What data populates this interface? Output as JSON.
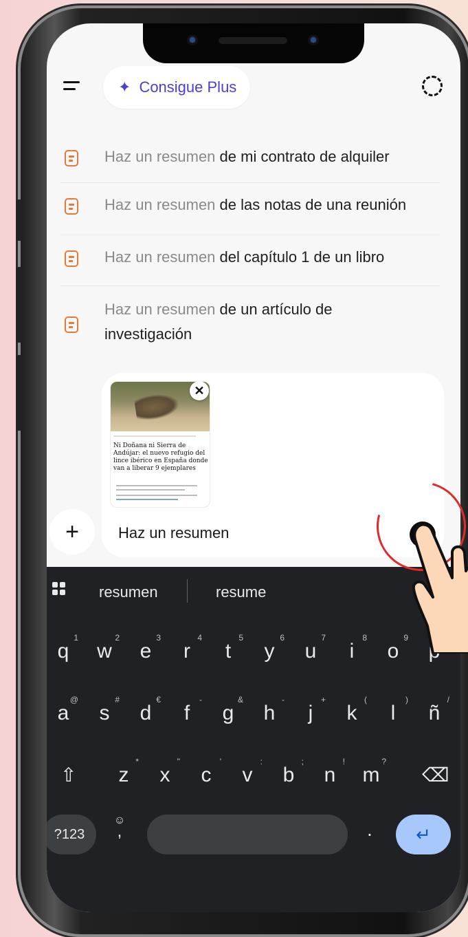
{
  "header": {
    "plus_label": "Consigue Plus"
  },
  "suggestions": [
    {
      "prefix": "Haz un resumen",
      "rest": "de mi contrato de alquiler"
    },
    {
      "prefix": "Haz un resumen",
      "rest": "de las notas de una reunión"
    },
    {
      "prefix": "Haz un resumen",
      "rest": "del capítulo 1 de un libro"
    },
    {
      "prefix": "Haz un resumen",
      "rest": "de un artículo de",
      "rest2": "investigación"
    }
  ],
  "attachment": {
    "headline": "Ni Doñana ni Sierra de Andújar: el nuevo refugio del lince ibérico en España donde van a liberar 9 ejemplares"
  },
  "composer": {
    "text": "Haz un resumen",
    "send_icon": "arrow-up-icon",
    "add_icon": "plus-icon"
  },
  "keyboard": {
    "suggestions": [
      "resumen",
      "resume"
    ],
    "row1": [
      {
        "k": "q",
        "s": "1"
      },
      {
        "k": "w",
        "s": "2"
      },
      {
        "k": "e",
        "s": "3"
      },
      {
        "k": "r",
        "s": "4"
      },
      {
        "k": "t",
        "s": "5"
      },
      {
        "k": "y",
        "s": "6"
      },
      {
        "k": "u",
        "s": "7"
      },
      {
        "k": "i",
        "s": "8"
      },
      {
        "k": "o",
        "s": "9"
      },
      {
        "k": "p",
        "s": "0"
      }
    ],
    "row2": [
      {
        "k": "a",
        "s": "@"
      },
      {
        "k": "s",
        "s": "#"
      },
      {
        "k": "d",
        "s": "€"
      },
      {
        "k": "f",
        "s": "-"
      },
      {
        "k": "g",
        "s": "&"
      },
      {
        "k": "h",
        "s": "-"
      },
      {
        "k": "j",
        "s": "+"
      },
      {
        "k": "k",
        "s": "("
      },
      {
        "k": "l",
        "s": ")"
      },
      {
        "k": "ñ",
        "s": "/"
      }
    ],
    "row3": [
      {
        "k": "z",
        "s": "*"
      },
      {
        "k": "x",
        "s": "\""
      },
      {
        "k": "c",
        "s": "'"
      },
      {
        "k": "v",
        "s": ":"
      },
      {
        "k": "b",
        "s": ";"
      },
      {
        "k": "n",
        "s": "!"
      },
      {
        "k": "m",
        "s": "?"
      }
    ],
    "key_123": "?123",
    "period": ".",
    "comma": ","
  },
  "colors": {
    "accent": "#4a3fd0",
    "doc_icon": "#e8773a",
    "keyboard_bg": "#202124",
    "enter_bg": "#a8c7fa",
    "annotation": "#e12b2b"
  }
}
